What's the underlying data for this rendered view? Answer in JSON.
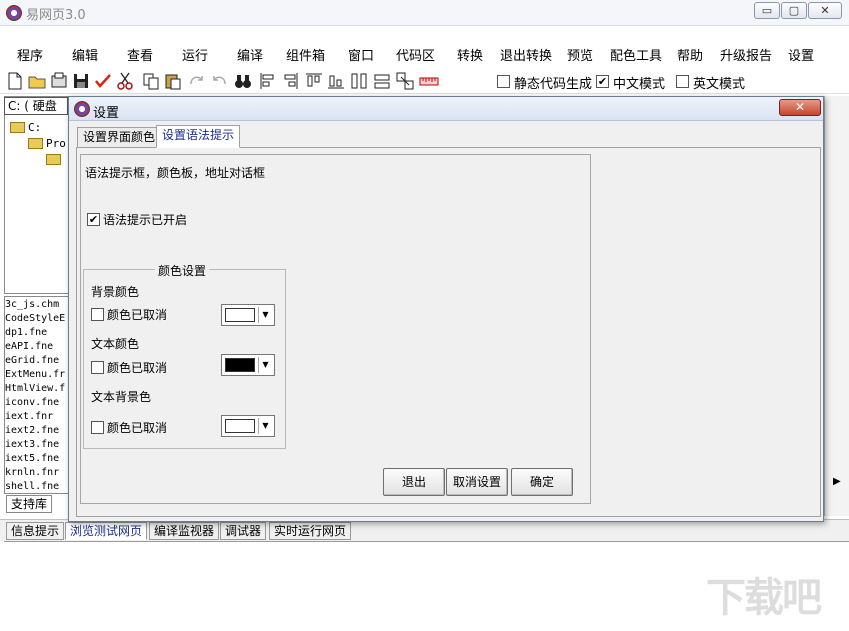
{
  "app": {
    "title": "易网页3.0",
    "window_buttons": {
      "minimize": "▭",
      "maximize": "▢",
      "close": "✕"
    }
  },
  "menu": [
    "程序",
    "编辑",
    "查看",
    "运行",
    "编译",
    "组件箱",
    "窗口",
    "代码区",
    "转换",
    "退出转换",
    "预览",
    "配色工具",
    "帮助",
    "升级报告",
    "设置"
  ],
  "toolbar": {
    "options": [
      {
        "label": "静态代码生成",
        "checked": false
      },
      {
        "label": "中文模式",
        "checked": true
      },
      {
        "label": "英文模式",
        "checked": false
      }
    ]
  },
  "left_panel": {
    "drive": "C: ( 硬盘",
    "tree": [
      "C:",
      "Pro",
      ""
    ],
    "files": [
      "3c_js.chm",
      "CodeStyleE",
      "dp1.fne",
      "eAPI.fne",
      "eGrid.fne",
      "ExtMenu.fr",
      "HtmlView.f",
      "iconv.fne",
      "iext.fnr",
      "iext2.fne",
      "iext3.fne",
      "iext5.fne",
      "krnln.fnr",
      "shell.fne"
    ],
    "lib_tab": "支持库"
  },
  "bottom_tabs": [
    {
      "label": "信息提示",
      "active": false
    },
    {
      "label": "浏览测试网页",
      "active": true
    },
    {
      "label": "编译监视器",
      "active": false
    },
    {
      "label": "调试器",
      "active": false
    },
    {
      "label": "实时运行网页",
      "active": false
    }
  ],
  "dialog": {
    "title": "设置",
    "close_label": "✕",
    "tabs": [
      {
        "label": "设置界面颜色",
        "active": false
      },
      {
        "label": "设置语法提示",
        "active": true
      }
    ],
    "description": "语法提示框，颜色板，地址对话框",
    "syntax_enabled": {
      "label": "语法提示已开启",
      "checked": true
    },
    "color_group": {
      "title": "颜色设置",
      "background": {
        "label": "背景颜色",
        "cancel_label": "颜色已取消",
        "checked": false,
        "color": "#ffffff"
      },
      "text": {
        "label": "文本颜色",
        "cancel_label": "颜色已取消",
        "checked": false,
        "color": "#000000"
      },
      "text_background": {
        "label": "文本背景色",
        "cancel_label": "颜色已取消",
        "checked": false,
        "color": "#ffffff"
      }
    },
    "buttons": {
      "exit": "退出",
      "cancel": "取消设置",
      "ok": "确定"
    }
  },
  "watermark": "下载吧"
}
